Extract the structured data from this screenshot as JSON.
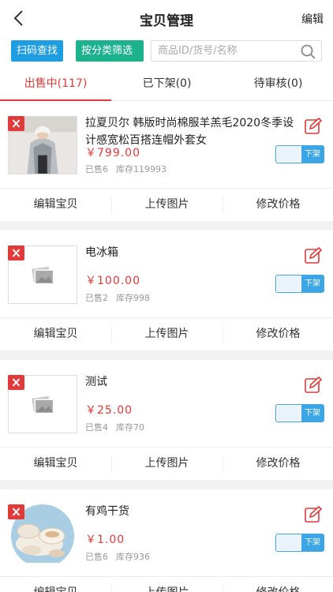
{
  "header": {
    "title": "宝贝管理",
    "edit_label": "编辑",
    "back_icon": "chevron-left-icon"
  },
  "toolbar": {
    "scan_label": "扫码查找",
    "category_label": "按分类筛选",
    "search_placeholder": "商品ID/货号/名称",
    "search_value": "",
    "scan_color": "#1e9ee0",
    "category_color": "#1cb28e"
  },
  "tabs": [
    {
      "label": "出售中(117)",
      "active": true
    },
    {
      "label": "已下架(0)",
      "active": false
    },
    {
      "label": "待审核(0)",
      "active": false
    }
  ],
  "accent_color": "#e03a3a",
  "products": [
    {
      "title": "拉夏贝尔  韩版时尚棉服羊羔毛2020冬季设计感宽松百搭连帽外套女",
      "price": "￥799.00",
      "sold": "已售6",
      "stock": "库存119993",
      "toggle_label": "下架",
      "image": "product-photo-coat"
    },
    {
      "title": "电冰箱",
      "price": "￥100.00",
      "sold": "已售2",
      "stock": "库存998",
      "toggle_label": "下架",
      "image": "image-placeholder-icon"
    },
    {
      "title": "测试",
      "price": "￥25.00",
      "sold": "已售4",
      "stock": "库存70",
      "toggle_label": "下架",
      "image": "image-placeholder-icon"
    },
    {
      "title": "有鸡干货",
      "price": "￥1.00",
      "sold": "已售6",
      "stock": "库存936",
      "toggle_label": "下架",
      "image": "product-photo-bowls"
    }
  ],
  "actions": {
    "edit": "编辑宝贝",
    "upload": "上传图片",
    "price": "修改价格"
  }
}
